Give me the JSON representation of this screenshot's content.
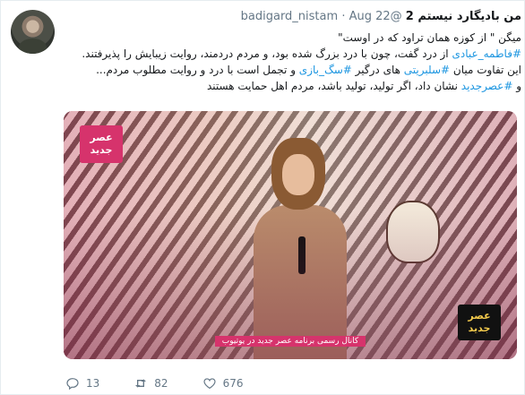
{
  "tweet": {
    "display_name": "من بادیگارد نیستم 2",
    "handle": "@badigard_nistam",
    "separator": "·",
    "date": "Aug 22",
    "text": {
      "line1": "میگن \" از کوزه همان تراود که در اوست\"",
      "line2_tag": "#فاطمه_عبادی",
      "line2_rest": " از درد گفت، چون با درد بزرگ شده بود، و مردم دردمند، روایت زیبایش را پذیرفتند.",
      "line3_a": "این تفاوت میان ",
      "line3_tag1": "#سلبریتی",
      "line3_b": " های درگیر ",
      "line3_tag2": "#سگ_بازی",
      "line3_c": " و تجمل است با درد و روایت مطلوب مردم...",
      "line4_a": "و ",
      "line4_tag": "#عصرجدید",
      "line4_b": " نشان داد، اگر تولید، تولید باشد، مردم اهل حمایت هستند"
    },
    "media": {
      "logo_top_left": "عصر جدید",
      "logo_bottom_right": "عصر جدید",
      "caption": "کانال رسمی برنامه عصر جدید در یوتیوب"
    },
    "actions": {
      "reply_count": "13",
      "retweet_count": "82",
      "like_count": "676"
    }
  },
  "colors": {
    "link": "#1b95e0",
    "muted": "#657786",
    "text": "#14171a",
    "border": "#e6ecf0"
  },
  "icons": [
    "reply-icon",
    "retweet-icon",
    "like-icon"
  ]
}
